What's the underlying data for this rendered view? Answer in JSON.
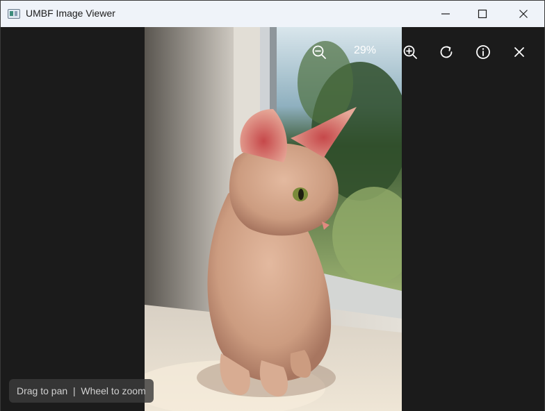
{
  "window": {
    "title": "UMBF Image Viewer",
    "controls": [
      "minimize-icon",
      "maximize-icon",
      "close-icon"
    ]
  },
  "toolbar": {
    "zoom_out_icon": "zoom-out-icon",
    "zoom_level": "29%",
    "zoom_in_icon": "zoom-in-icon",
    "rotate_icon": "rotate-icon",
    "info_icon": "info-icon",
    "close_icon": "close-icon"
  },
  "hint": {
    "text": "Drag to pan  |  Wheel to zoom"
  },
  "colors": {
    "titlebar": "#eff3f9",
    "viewer_background": "#1b1b1b",
    "toolbar_icon": "#ffffff",
    "hint_background": "#3c3c3c"
  }
}
